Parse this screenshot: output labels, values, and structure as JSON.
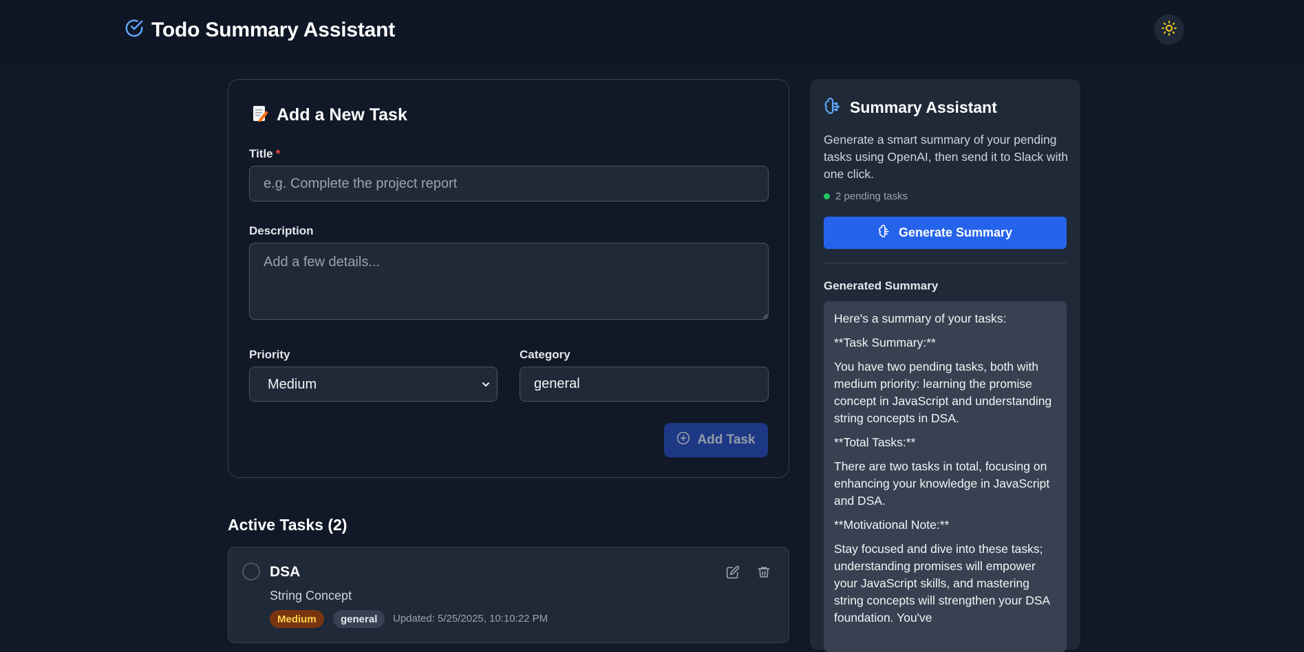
{
  "header": {
    "title": "Todo Summary Assistant",
    "logo_icon": "check-circle-icon",
    "theme_icon": "sun-icon",
    "accent": "#60a5fa",
    "sun_color": "#facc15"
  },
  "add_task": {
    "heading_icon": "memo-emoji",
    "heading": "Add a New Task",
    "title_label": "Title",
    "required_mark": "*",
    "title_placeholder": "e.g. Complete the project report",
    "title_value": "",
    "description_label": "Description",
    "description_placeholder": "Add a few details...",
    "description_value": "",
    "priority_label": "Priority",
    "priority_value": "Medium",
    "category_label": "Category",
    "category_value": "general",
    "submit_label": "Add Task"
  },
  "active_tasks": {
    "heading": "Active Tasks (2)",
    "items": [
      {
        "title": "DSA",
        "description": "String Concept",
        "priority": "Medium",
        "category": "general",
        "updated": "Updated: 5/25/2025, 10:10:22 PM"
      }
    ]
  },
  "summary": {
    "heading": "Summary Assistant",
    "heading_icon": "brain-icon",
    "description": "Generate a smart summary of your pending tasks using OpenAI, then send it to Slack with one click.",
    "pending": "2 pending tasks",
    "generate_label": "Generate Summary",
    "generated_label": "Generated Summary",
    "paragraphs": [
      "Here's a summary of your tasks:",
      "**Task Summary:**",
      "You have two pending tasks, both with medium priority: learning the promise concept in JavaScript and understanding string concepts in DSA.",
      "**Total Tasks:**",
      "There are two tasks in total, focusing on enhancing your knowledge in JavaScript and DSA.",
      "**Motivational Note:**",
      "Stay focused and dive into these tasks; understanding promises will empower your JavaScript skills, and mastering string concepts will strengthen your DSA foundation. You've"
    ]
  }
}
